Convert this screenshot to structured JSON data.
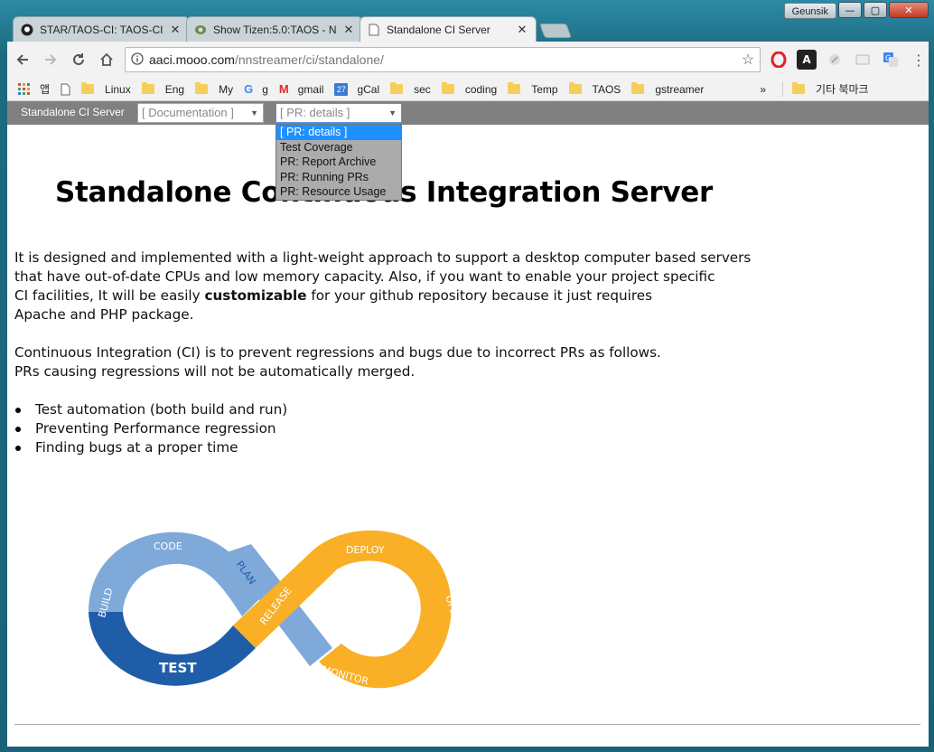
{
  "window": {
    "user": "Geunsik",
    "minimize": "—",
    "maximize": "▢",
    "close": "✕"
  },
  "tabs": [
    {
      "title": "STAR/TAOS-CI: TAOS-CI",
      "icon": "github-icon",
      "close": "✕"
    },
    {
      "title": "Show Tizen:5.0:TAOS - N",
      "icon": "obs-icon",
      "close": "✕"
    },
    {
      "title": "Standalone CI Server",
      "icon": "page-icon",
      "close": "✕"
    }
  ],
  "address": {
    "host": "aaci.mooo.com",
    "path": "/nnstreamer/ci/standalone/"
  },
  "bookmarks": {
    "apps": "앱",
    "items": [
      "Linux",
      "Eng",
      "My",
      "g",
      "gmail",
      "gCal",
      "sec",
      "coding",
      "Temp",
      "TAOS",
      "gstreamer"
    ],
    "calendar_day": "27",
    "more": "»",
    "other": "기타 북마크"
  },
  "site": {
    "brand": "Standalone CI Server",
    "doc_select": "[ Documentation ]",
    "pr_select": "[ PR: details ]",
    "pr_options": [
      "[ PR: details ]",
      "Test Coverage",
      "PR: Report Archive",
      "PR: Running PRs",
      "PR: Resource Usage"
    ]
  },
  "content": {
    "title": "Standalone Continuous Integration Server",
    "p1": [
      "It is designed and implemented with a light-weight approach to support a desktop computer based servers",
      "that have out-of-date CPUs and low memory capacity. Also, if you want to enable your project specific",
      "CI facilities, It will be easily ",
      "customizable",
      " for your github repository because it just requires",
      "Apache and PHP package."
    ],
    "p2": [
      "Continuous Integration (CI) is to prevent regressions and bugs due to incorrect PRs as follows.",
      "PRs causing regressions will not be automatically merged."
    ],
    "bullets": [
      "Test automation (both build and run)",
      "Preventing Performance regression",
      "Finding bugs at a proper time"
    ]
  },
  "devops": {
    "labels": {
      "code": "CODE",
      "build": "BUILD",
      "test": "TEST",
      "plan": "PLAN",
      "release": "RELEASE",
      "deploy": "DEPLOY",
      "operate": "OPERATE",
      "monitor": "MONITOR"
    },
    "colors": {
      "light_blue": "#7fa9d9",
      "dark_blue": "#1f5da8",
      "orange": "#f9af26"
    }
  }
}
